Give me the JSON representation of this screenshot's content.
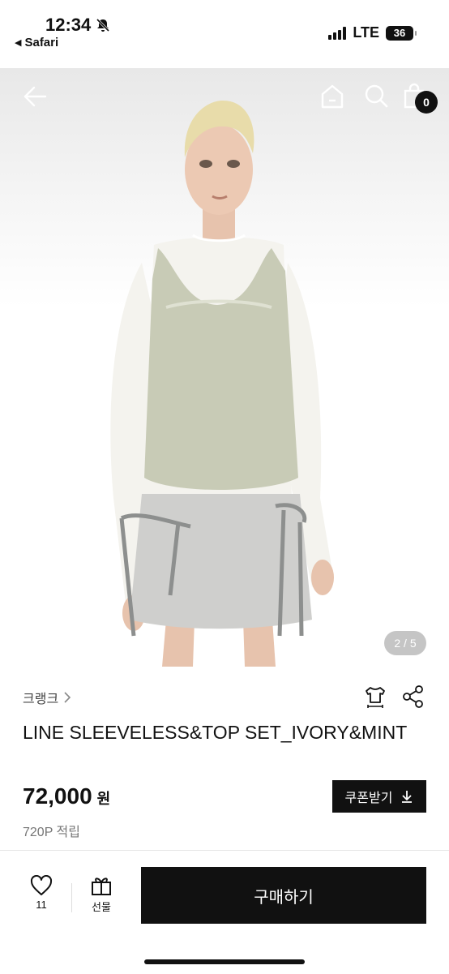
{
  "status_bar": {
    "time": "12:34",
    "back_app": "Safari",
    "network": "LTE",
    "battery": "36"
  },
  "hero": {
    "cart_count": "0",
    "page_indicator": "2 / 5"
  },
  "product": {
    "brand": "크랭크",
    "title": "LINE SLEEVELESS&TOP SET_IVORY&MINT",
    "price": "72,000",
    "currency": "원",
    "points": "720P 적립",
    "coupon_label": "쿠폰받기"
  },
  "bottom_bar": {
    "like_count": "11",
    "gift_label": "선물",
    "buy_label": "구매하기"
  }
}
